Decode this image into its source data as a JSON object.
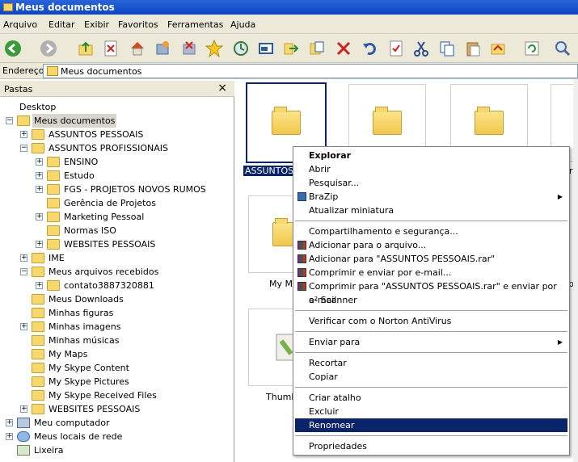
{
  "window": {
    "title": "Meus documentos"
  },
  "menu": [
    "Arquivo",
    "Editar",
    "Exibir",
    "Favoritos",
    "Ferramentas",
    "Ajuda"
  ],
  "toolbar": {
    "icons": [
      "back-icon",
      "forward-icon",
      "up-folder-icon",
      "delete-icon",
      "home-icon",
      "history-icon",
      "move-to-icon",
      "favorites-star-icon",
      "sync-icon",
      "map-drive-icon",
      "arrow-icon",
      "copy-to-icon",
      "cancel-x-icon",
      "undo-icon",
      "properties-icon",
      "cut-icon",
      "copy-icon",
      "paste-icon",
      "move-icon",
      "refresh-icon",
      "search-icon"
    ]
  },
  "address": {
    "label": "Endereço",
    "value": "Meus documentos"
  },
  "folders_pane": {
    "title": "Pastas",
    "tree": [
      {
        "label": "Desktop",
        "level": 0,
        "expander": "",
        "icon": "desktop"
      },
      {
        "label": "Meus documentos",
        "level": 1,
        "expander": "-",
        "icon": "special",
        "selected": true
      },
      {
        "label": "ASSUNTOS PESSOAIS",
        "level": 2,
        "expander": "+",
        "icon": "folder"
      },
      {
        "label": "ASSUNTOS PROFISSIONAIS",
        "level": 2,
        "expander": "-",
        "icon": "folder"
      },
      {
        "label": "ENSINO",
        "level": 3,
        "expander": "+",
        "icon": "folder"
      },
      {
        "label": "Estudo",
        "level": 3,
        "expander": "+",
        "icon": "folder"
      },
      {
        "label": "FGS - PROJETOS NOVOS RUMOS",
        "level": 3,
        "expander": "+",
        "icon": "folder"
      },
      {
        "label": "Gerência de Projetos",
        "level": 3,
        "expander": "",
        "icon": "folder"
      },
      {
        "label": "Marketing Pessoal",
        "level": 3,
        "expander": "+",
        "icon": "folder"
      },
      {
        "label": "Normas ISO",
        "level": 3,
        "expander": "",
        "icon": "folder"
      },
      {
        "label": "WEBSITES PESSOAIS",
        "level": 3,
        "expander": "+",
        "icon": "folder"
      },
      {
        "label": "IME",
        "level": 2,
        "expander": "+",
        "icon": "folder"
      },
      {
        "label": "Meus arquivos recebidos",
        "level": 2,
        "expander": "-",
        "icon": "folder"
      },
      {
        "label": "contato3887320881",
        "level": 3,
        "expander": "+",
        "icon": "folder"
      },
      {
        "label": "Meus Downloads",
        "level": 2,
        "expander": "",
        "icon": "folder"
      },
      {
        "label": "Minhas figuras",
        "level": 2,
        "expander": "",
        "icon": "folder"
      },
      {
        "label": "Minhas imagens",
        "level": 2,
        "expander": "+",
        "icon": "special"
      },
      {
        "label": "Minhas músicas",
        "level": 2,
        "expander": "",
        "icon": "special"
      },
      {
        "label": "My Maps",
        "level": 2,
        "expander": "",
        "icon": "folder"
      },
      {
        "label": "My Skype Content",
        "level": 2,
        "expander": "",
        "icon": "folder"
      },
      {
        "label": "My Skype Pictures",
        "level": 2,
        "expander": "",
        "icon": "folder"
      },
      {
        "label": "My Skype Received Files",
        "level": 2,
        "expander": "",
        "icon": "folder"
      },
      {
        "label": "WEBSITES PESSOAIS",
        "level": 2,
        "expander": "+",
        "icon": "folder"
      },
      {
        "label": "Meu computador",
        "level": 1,
        "expander": "+",
        "icon": "pc"
      },
      {
        "label": "Meus locais de rede",
        "level": 1,
        "expander": "+",
        "icon": "net"
      },
      {
        "label": "Lixeira",
        "level": 1,
        "expander": "",
        "icon": "bin"
      }
    ]
  },
  "content": {
    "selected_caption": "ASSUNTOS P",
    "captions": [
      "rq",
      "My Ma",
      "pe",
      "Thumbs"
    ]
  },
  "context_menu": {
    "items": [
      {
        "label": "Explorar",
        "bold": true
      },
      {
        "label": "Abrir"
      },
      {
        "label": "Pesquisar..."
      },
      {
        "label": "BraZip",
        "submenu": true,
        "icon": "brazip-icon"
      },
      {
        "label": "Atualizar miniatura"
      },
      {
        "sep": true
      },
      {
        "label": "Compartilhamento e segurança..."
      },
      {
        "label": "Adicionar para o arquivo...",
        "icon": "rar-icon"
      },
      {
        "label": "Adicionar para \"ASSUNTOS PESSOAIS.rar\"",
        "icon": "rar-icon"
      },
      {
        "label": "Comprimir e enviar por e-mail...",
        "icon": "rar-icon"
      },
      {
        "label": "Comprimir para \"ASSUNTOS PESSOAIS.rar\" e enviar por e-mail",
        "icon": "rar-icon"
      },
      {
        "label": "a² Scanner"
      },
      {
        "sep": true
      },
      {
        "label": "Verificar com o Norton AntiVirus"
      },
      {
        "sep": true
      },
      {
        "label": "Enviar para",
        "submenu": true
      },
      {
        "sep": true
      },
      {
        "label": "Recortar"
      },
      {
        "label": "Copiar"
      },
      {
        "sep": true
      },
      {
        "label": "Criar atalho"
      },
      {
        "label": "Excluir"
      },
      {
        "label": "Renomear",
        "highlighted": true
      },
      {
        "sep": true
      },
      {
        "label": "Propriedades"
      }
    ]
  }
}
